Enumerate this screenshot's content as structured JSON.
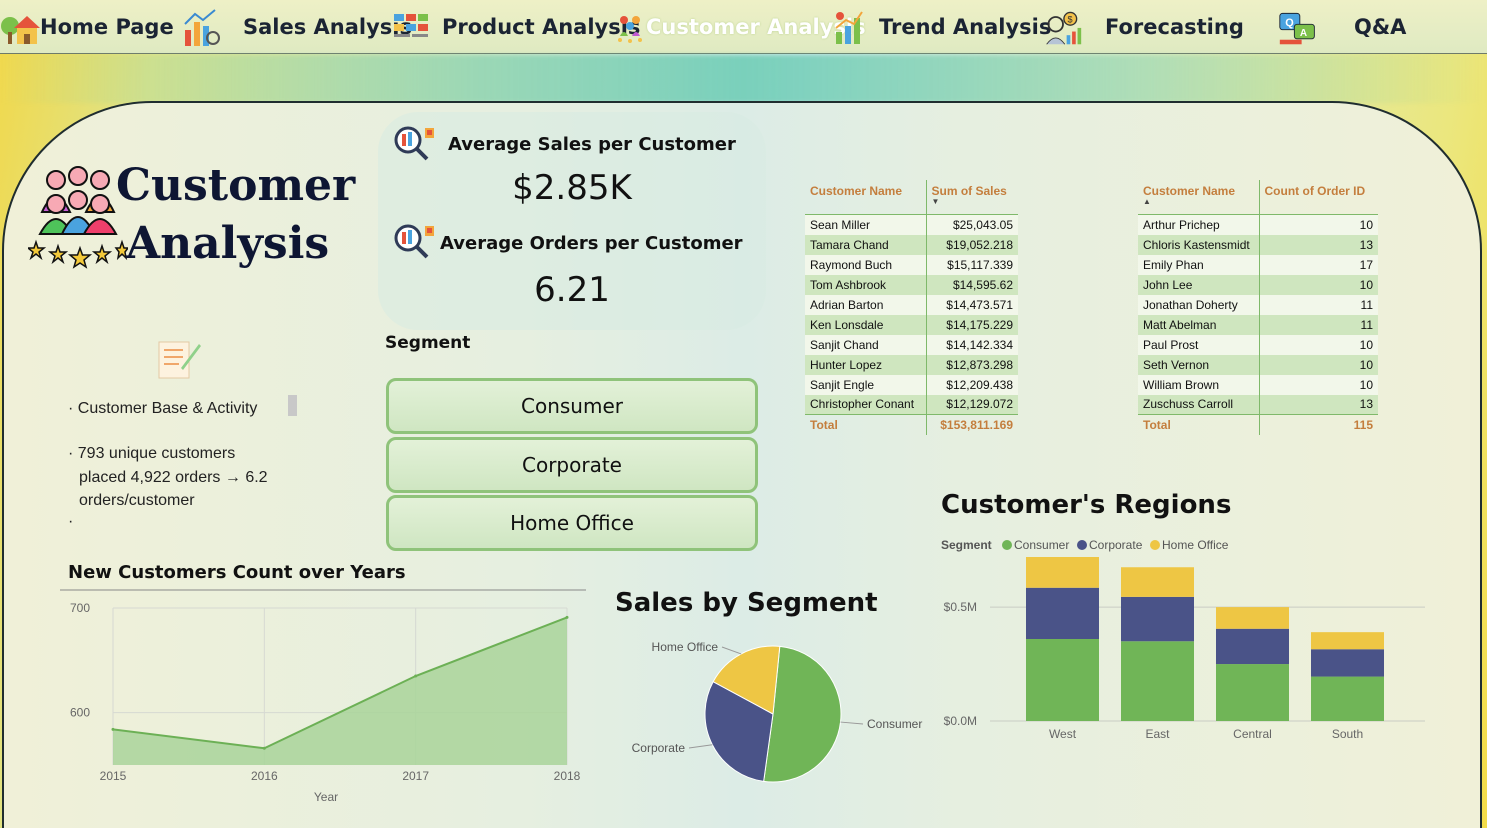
{
  "nav": {
    "items": [
      {
        "label": "Home Page",
        "icon": "house-icon"
      },
      {
        "label": "Sales Analysis",
        "icon": "bar-chart-icon"
      },
      {
        "label": "Product Analysis",
        "icon": "product-grid-icon"
      },
      {
        "label": "Customer Analysis",
        "icon": "people-group-icon",
        "active": true
      },
      {
        "label": "Trend Analysis",
        "icon": "trend-bars-icon"
      },
      {
        "label": "Forecasting",
        "icon": "analyst-icon"
      },
      {
        "label": "Q&A",
        "icon": "qa-chat-icon"
      }
    ]
  },
  "page": {
    "title_line1": "Customer",
    "title_line2": "Analysis"
  },
  "kpis": {
    "avg_sales_label": "Average Sales per Customer",
    "avg_sales_value": "$2.85K",
    "avg_orders_label": "Average Orders per Customer",
    "avg_orders_value": "6.21"
  },
  "segment_slicer": {
    "label": "Segment",
    "options": [
      "Consumer",
      "Corporate",
      "Home Office"
    ]
  },
  "notes": {
    "heading": "Customer Base & Activity",
    "line1": "793 unique customers",
    "line2": "placed 4,922 orders → 6.2",
    "line3": "orders/customer"
  },
  "sales_table": {
    "headers": [
      "Customer Name",
      "Sum of Sales"
    ],
    "rows": [
      [
        "Sean Miller",
        "$25,043.05"
      ],
      [
        "Tamara Chand",
        "$19,052.218"
      ],
      [
        "Raymond Buch",
        "$15,117.339"
      ],
      [
        "Tom Ashbrook",
        "$14,595.62"
      ],
      [
        "Adrian Barton",
        "$14,473.571"
      ],
      [
        "Ken Lonsdale",
        "$14,175.229"
      ],
      [
        "Sanjit Chand",
        "$14,142.334"
      ],
      [
        "Hunter Lopez",
        "$12,873.298"
      ],
      [
        "Sanjit Engle",
        "$12,209.438"
      ],
      [
        "Christopher Conant",
        "$12,129.072"
      ]
    ],
    "total_label": "Total",
    "total_value": "$153,811.169"
  },
  "orders_table": {
    "headers": [
      "Customer Name",
      "Count of Order ID"
    ],
    "rows": [
      [
        "Arthur Prichep",
        "10"
      ],
      [
        "Chloris Kastensmidt",
        "13"
      ],
      [
        "Emily Phan",
        "17"
      ],
      [
        "John Lee",
        "10"
      ],
      [
        "Jonathan Doherty",
        "11"
      ],
      [
        "Matt Abelman",
        "11"
      ],
      [
        "Paul Prost",
        "10"
      ],
      [
        "Seth Vernon",
        "10"
      ],
      [
        "William Brown",
        "10"
      ],
      [
        "Zuschuss Carroll",
        "13"
      ]
    ],
    "total_label": "Total",
    "total_value": "115"
  },
  "colors": {
    "consumer": "#70b557",
    "corporate": "#4a5388",
    "home_office": "#eec644",
    "area": "#a9d49a",
    "area_line": "#6cb055"
  },
  "chart_data": [
    {
      "id": "new_customers",
      "type": "area",
      "title": "New Customers Count over Years",
      "xlabel": "Year",
      "ylabel": "",
      "x": [
        2015,
        2016,
        2017,
        2018
      ],
      "values": [
        584,
        566,
        635,
        691
      ],
      "x_ticks": [
        "2015",
        "2016",
        "2017",
        "2018"
      ],
      "y_ticks": [
        "700",
        "600"
      ],
      "ylim": [
        550,
        700
      ]
    },
    {
      "id": "sales_by_segment",
      "type": "pie",
      "title": "Sales by Segment",
      "categories": [
        "Consumer",
        "Corporate",
        "Home Office"
      ],
      "values": [
        50.6,
        30.7,
        18.7
      ]
    },
    {
      "id": "customer_regions",
      "type": "bar",
      "title": "Customer's Regions",
      "legend_title": "Segment",
      "legend": [
        "Consumer",
        "Corporate",
        "Home Office"
      ],
      "categories": [
        "West",
        "East",
        "Central",
        "South"
      ],
      "series": [
        {
          "name": "Consumer",
          "values": [
            0.36,
            0.35,
            0.25,
            0.195
          ]
        },
        {
          "name": "Corporate",
          "values": [
            0.225,
            0.195,
            0.155,
            0.12
          ]
        },
        {
          "name": "Home Office",
          "values": [
            0.135,
            0.13,
            0.095,
            0.075
          ]
        }
      ],
      "y_ticks": [
        "$0.5M",
        "$0.0M"
      ],
      "ylim": [
        0,
        0.72
      ]
    }
  ]
}
